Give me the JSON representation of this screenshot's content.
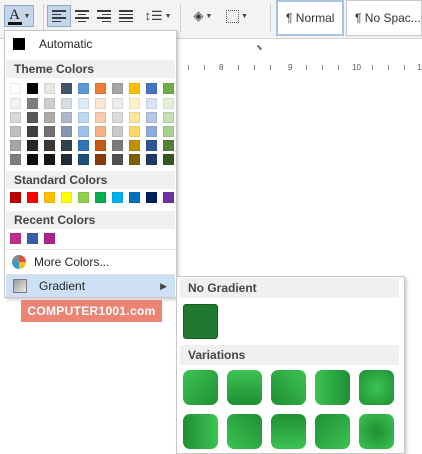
{
  "ribbon": {
    "font_color_letter": "A",
    "styles": [
      "¶ Normal",
      "¶ No Spac..."
    ]
  },
  "ruler": {
    "numbers": [
      "8",
      "9",
      "10",
      "11"
    ]
  },
  "font_color_menu": {
    "automatic_label": "Automatic",
    "theme_colors_label": "Theme Colors",
    "standard_colors_label": "Standard Colors",
    "recent_colors_label": "Recent Colors",
    "more_colors_label": "More Colors...",
    "gradient_label": "Gradient",
    "theme_colors": [
      [
        "#ffffff",
        "#f2f2f2",
        "#d8d8d8",
        "#bfbfbf",
        "#a5a5a5",
        "#7f7f7f"
      ],
      [
        "#000000",
        "#7f7f7f",
        "#595959",
        "#3f3f3f",
        "#262626",
        "#0c0c0c"
      ],
      [
        "#e7e6e6",
        "#d0cece",
        "#aeabab",
        "#757070",
        "#3a3838",
        "#171616"
      ],
      [
        "#44546a",
        "#d6dce4",
        "#adb9ca",
        "#8496b0",
        "#323f4f",
        "#222a35"
      ],
      [
        "#5b9bd5",
        "#deebf6",
        "#bdd7ee",
        "#9dc3e6",
        "#2e75b5",
        "#1f4e79"
      ],
      [
        "#ed7d31",
        "#fbe5d5",
        "#f7cbac",
        "#f4b183",
        "#c55a11",
        "#843c0b"
      ],
      [
        "#a5a5a5",
        "#ededed",
        "#dbdbdb",
        "#c9c9c9",
        "#7b7b7b",
        "#525252"
      ],
      [
        "#ffc000",
        "#fff2cc",
        "#fee599",
        "#ffd965",
        "#bf9000",
        "#7f6000"
      ],
      [
        "#4472c4",
        "#dae3f3",
        "#b4c7e7",
        "#8faadc",
        "#2f5597",
        "#203864"
      ],
      [
        "#70ad47",
        "#e2efd9",
        "#c5e0b3",
        "#a8d08d",
        "#538135",
        "#375623"
      ]
    ],
    "standard_colors": [
      "#c00000",
      "#ff0000",
      "#ffc000",
      "#ffff00",
      "#92d050",
      "#00b050",
      "#00b0f0",
      "#0070c0",
      "#002060",
      "#7030a0"
    ],
    "recent_colors": [
      "#c0308a",
      "#3b5ca8",
      "#b3208f"
    ]
  },
  "gradient_menu": {
    "no_gradient_label": "No Gradient",
    "variations_label": "Variations",
    "no_gradient_color": "#1f7a2f",
    "variation_colors": [
      "#1f8f33",
      "#3cc353"
    ]
  },
  "logo": {
    "text": "COMPUTER1001.com",
    "color": "#ec8474"
  }
}
